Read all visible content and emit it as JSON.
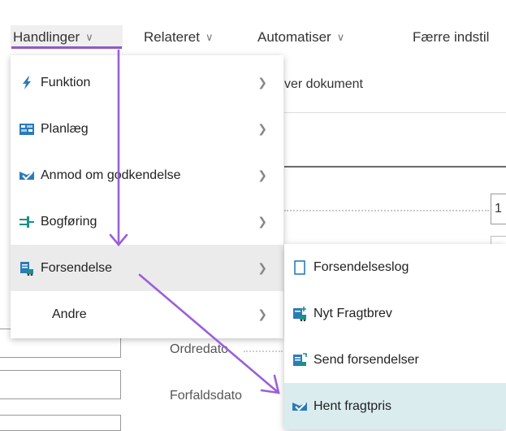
{
  "topbar": {
    "items": [
      {
        "label": "Handlinger"
      },
      {
        "label": "Relateret"
      },
      {
        "label": "Automatiser"
      },
      {
        "label": "Færre indstil"
      }
    ]
  },
  "background": {
    "document_text": "ver dokument",
    "fields": [
      {
        "label": "Ordredato"
      },
      {
        "label": "Forfaldsdato"
      }
    ],
    "edge_value": "1"
  },
  "menu": {
    "items": [
      {
        "label": "Funktion",
        "icon": "lightning-icon"
      },
      {
        "label": "Planlæg",
        "icon": "plan-icon"
      },
      {
        "label": "Anmod om godkendelse",
        "icon": "approval-icon"
      },
      {
        "label": "Bogføring",
        "icon": "post-icon"
      },
      {
        "label": "Forsendelse",
        "icon": "shipment-icon"
      },
      {
        "label": "Andre",
        "icon": ""
      }
    ],
    "selected_index": 4
  },
  "submenu": {
    "items": [
      {
        "label": "Forsendelseslog",
        "icon": "document-outline-icon"
      },
      {
        "label": "Nyt Fragtbrev",
        "icon": "new-waybill-icon"
      },
      {
        "label": "Send forsendelser",
        "icon": "send-shipments-icon"
      },
      {
        "label": "Hent fragtpris",
        "icon": "get-rate-icon"
      }
    ],
    "highlighted_index": 3
  },
  "colors": {
    "accent": "#8b5cc7",
    "icon_blue": "#2b7bb9",
    "icon_teal": "#1c8f8a",
    "selected_bg": "#ebebeb",
    "highlight_bg": "#dbecef"
  }
}
